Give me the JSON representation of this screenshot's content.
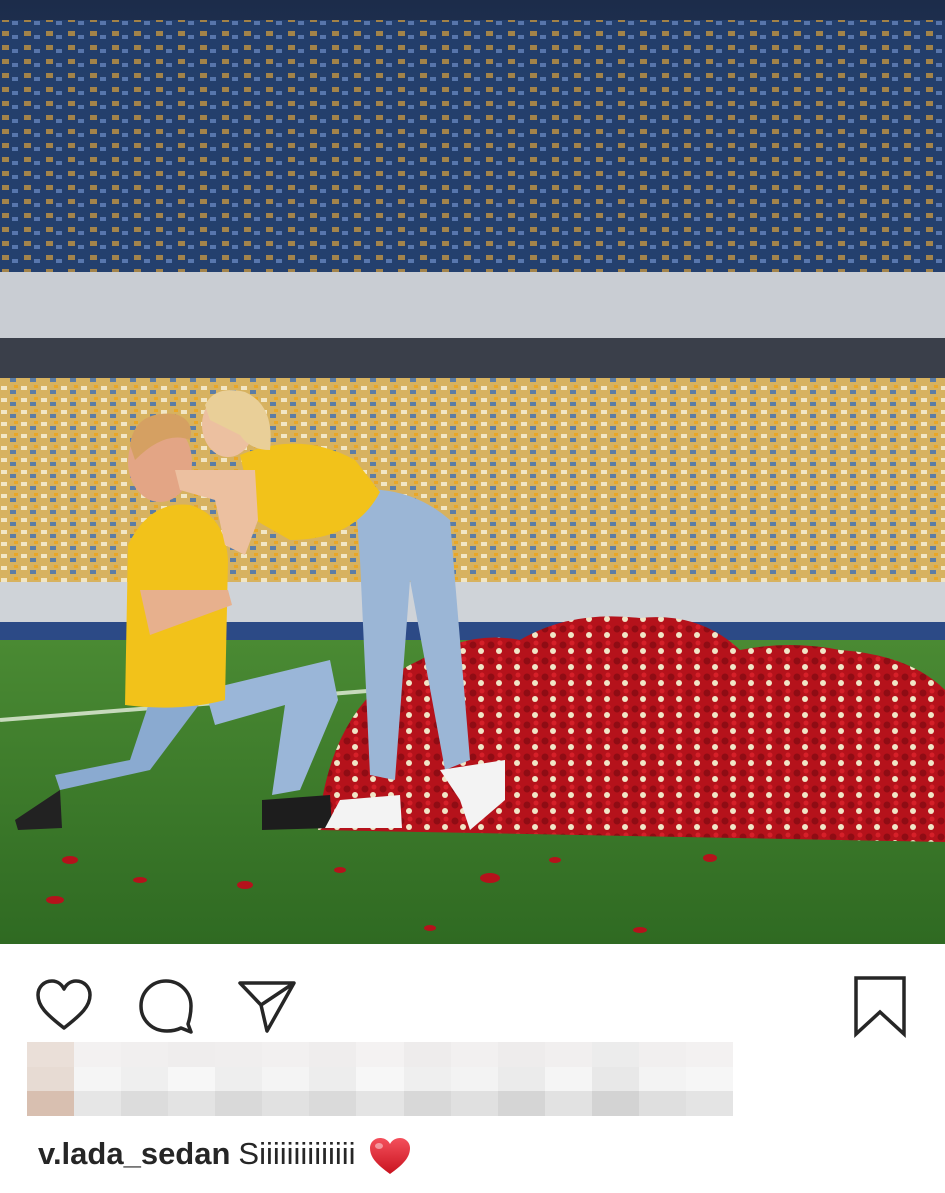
{
  "post": {
    "username": "v.lada_sedan",
    "caption_text": "Siiiiiiiiiiiiii"
  },
  "actions": {
    "like_icon": "heart-outline-icon",
    "comment_icon": "speech-bubble-icon",
    "share_icon": "paper-plane-icon",
    "save_icon": "bookmark-icon"
  },
  "colors": {
    "text": "#262626",
    "heart_emoji": "#e0202e",
    "jersey_yellow": "#f2c21a",
    "grass_green": "#3b7a2a",
    "rose_red": "#b5121b"
  }
}
